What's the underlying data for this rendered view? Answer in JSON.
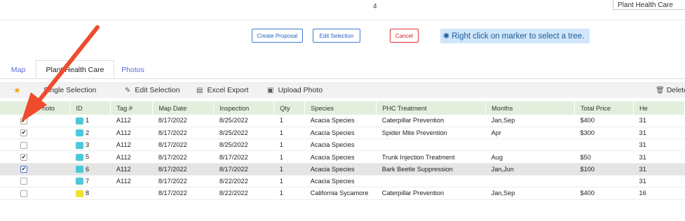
{
  "top": {
    "page_number": "4",
    "dropdown_value": "Plant Health Care"
  },
  "actions": {
    "create_proposal": "Create Proposal",
    "edit_selection": "Edit Selection",
    "cancel": "Cancel",
    "hint": "Right click on marker to select a tree."
  },
  "tabs": [
    "Map",
    "Plant Health Care",
    "Photos"
  ],
  "toolbar": {
    "single_selection": "Single Selection",
    "edit_selection": "Edit Selection",
    "excel_export": "Excel Export",
    "upload_photo": "Upload Photo",
    "delete": "Delete"
  },
  "columns": [
    "Photo",
    "ID",
    "Tag #",
    "Map Date",
    "Inspection",
    "Qty",
    "Species",
    "PHC Treatment",
    "Months",
    "Total Price",
    "He"
  ],
  "rows": [
    {
      "checked": true,
      "color": "#4cc9d8",
      "id": "1",
      "tag": "A112",
      "map_date": "8/17/2022",
      "inspection": "8/25/2022",
      "qty": "1",
      "species": "Acacia Species",
      "treatment": "Caterpillar Prevention",
      "months": "Jan,Sep",
      "price": "$400",
      "he": "31"
    },
    {
      "checked": true,
      "color": "#4cc9d8",
      "id": "2",
      "tag": "A112",
      "map_date": "8/17/2022",
      "inspection": "8/25/2022",
      "qty": "1",
      "species": "Acacia Species",
      "treatment": "Spider Mite Prevention",
      "months": "Apr",
      "price": "$300",
      "he": "31"
    },
    {
      "checked": false,
      "color": "#4cc9d8",
      "id": "3",
      "tag": "A112",
      "map_date": "8/17/2022",
      "inspection": "8/25/2022",
      "qty": "1",
      "species": "Acacia Species",
      "treatment": "",
      "months": "",
      "price": "",
      "he": "31"
    },
    {
      "checked": true,
      "color": "#4cc9d8",
      "id": "5",
      "tag": "A112",
      "map_date": "8/17/2022",
      "inspection": "8/17/2022",
      "qty": "1",
      "species": "Acacia Species",
      "treatment": "Trunk Injection Treatment",
      "months": "Aug",
      "price": "$50",
      "he": "31"
    },
    {
      "checked": true,
      "color": "#4cc9d8",
      "id": "6",
      "tag": "A112",
      "map_date": "8/17/2022",
      "inspection": "8/17/2022",
      "qty": "1",
      "species": "Acacia Species",
      "treatment": "Bark Beetle Suppression",
      "months": "Jan,Jun",
      "price": "$100",
      "he": "31",
      "highlighted": true
    },
    {
      "checked": false,
      "color": "#4cc9d8",
      "id": "7",
      "tag": "A112",
      "map_date": "8/17/2022",
      "inspection": "8/22/2022",
      "qty": "1",
      "species": "Acacia Species",
      "treatment": "",
      "months": "",
      "price": "",
      "he": "31"
    },
    {
      "checked": false,
      "color": "#f2e130",
      "id": "8",
      "tag": "",
      "map_date": "8/17/2022",
      "inspection": "8/22/2022",
      "qty": "1",
      "species": "California Sycamore",
      "treatment": "Caterpillar Prevention",
      "months": "Jan,Sep",
      "price": "$400",
      "he": "16"
    }
  ],
  "icons": {
    "star": "star-icon",
    "edit": "pencil-icon",
    "excel": "spreadsheet-icon",
    "upload": "image-icon",
    "delete": "trash-icon",
    "hint": "lightbulb-icon"
  },
  "colors": {
    "accent": "#3f7bd9",
    "cancel": "#dd3333",
    "hint_bg": "#cfe6fb",
    "header_bg": "#e4eedd",
    "arrow": "#ef4b2c"
  }
}
